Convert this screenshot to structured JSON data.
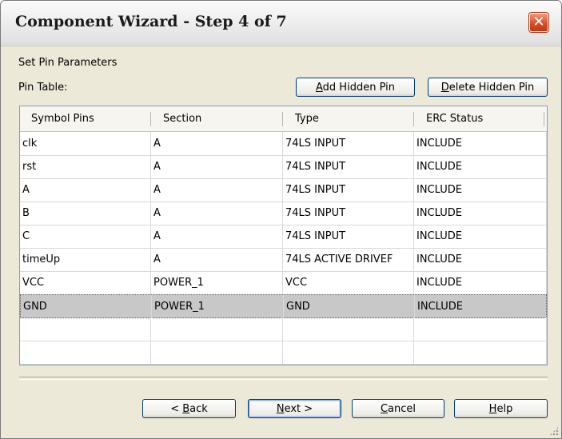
{
  "window": {
    "title": "Component Wizard - Step 4 of 7"
  },
  "labels": {
    "set_pin_parameters": "Set Pin Parameters",
    "pin_table": "Pin Table:"
  },
  "top_buttons": {
    "add_hidden": {
      "u": "A",
      "rest": "dd Hidden Pin"
    },
    "delete_hidden": {
      "u": "D",
      "rest": "elete Hidden Pin"
    }
  },
  "table": {
    "columns": [
      "Symbol Pins",
      "Section",
      "Type",
      "ERC Status"
    ],
    "rows": [
      [
        "clk",
        "A",
        "74LS INPUT",
        "INCLUDE"
      ],
      [
        "rst",
        "A",
        "74LS INPUT",
        "INCLUDE"
      ],
      [
        "A",
        "A",
        "74LS INPUT",
        "INCLUDE"
      ],
      [
        "B",
        "A",
        "74LS INPUT",
        "INCLUDE"
      ],
      [
        "C",
        "A",
        "74LS INPUT",
        "INCLUDE"
      ],
      [
        "timeUp",
        "A",
        "74LS ACTIVE DRIVEF",
        "INCLUDE"
      ],
      [
        "VCC",
        "POWER_1",
        "VCC",
        "INCLUDE"
      ],
      [
        "GND",
        "POWER_1",
        "GND",
        "INCLUDE"
      ],
      [
        "",
        "",
        "",
        ""
      ],
      [
        "",
        "",
        "",
        ""
      ]
    ],
    "selected_row": 7
  },
  "bottom_buttons": {
    "back": {
      "pre": "< ",
      "u": "B",
      "rest": "ack"
    },
    "next": {
      "pre": "",
      "u": "N",
      "rest": "ext >"
    },
    "cancel": {
      "pre": "",
      "u": "C",
      "rest": "ancel"
    },
    "help": {
      "pre": "",
      "u": "H",
      "rest": "elp"
    }
  },
  "icons": {
    "close": "close-icon",
    "resize": "resize-grip-icon"
  },
  "colors": {
    "dialog_bg": "#ece9d8",
    "close_red": "#d64b23",
    "selected_row": "#c8c8c8"
  }
}
